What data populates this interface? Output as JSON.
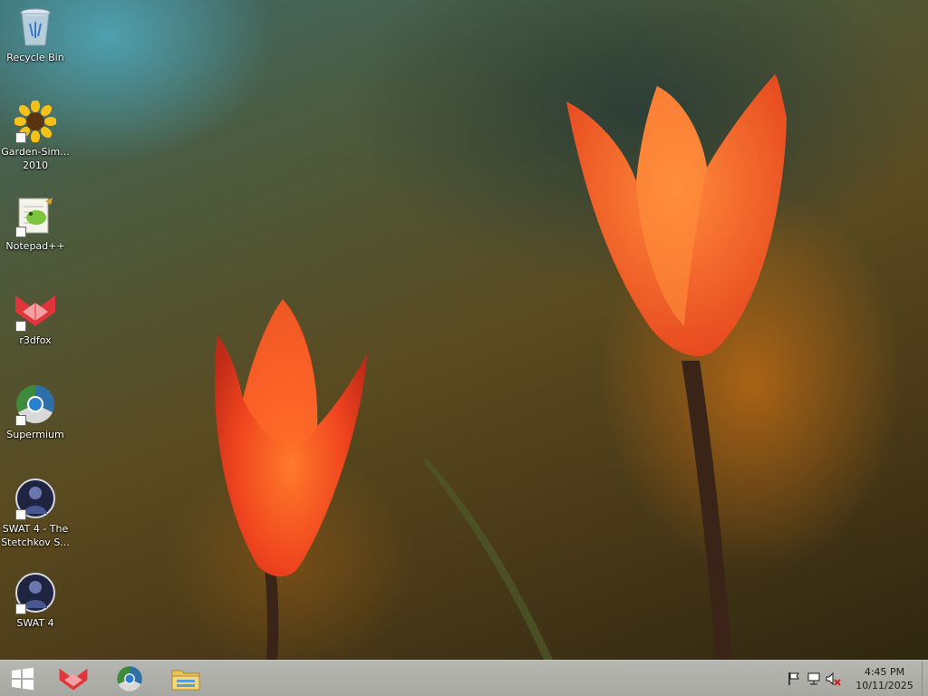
{
  "desktop": {
    "icons": [
      {
        "label": "Recycle Bin",
        "icon": "recycle-bin-icon",
        "shortcut": false
      },
      {
        "label": "Garden-Sim...\n2010",
        "icon": "sunflower-icon",
        "shortcut": true
      },
      {
        "label": "Notepad++",
        "icon": "notepad-plus-plus-icon",
        "shortcut": true
      },
      {
        "label": "r3dfox",
        "icon": "r3dfox-icon",
        "shortcut": true
      },
      {
        "label": "Supermium",
        "icon": "supermium-icon",
        "shortcut": true
      },
      {
        "label": "SWAT 4 - The\nStetchkov S...",
        "icon": "swat4-icon",
        "shortcut": true
      },
      {
        "label": "SWAT 4",
        "icon": "swat4-icon",
        "shortcut": true
      }
    ]
  },
  "taskbar": {
    "start_icon": "windows-logo-icon",
    "pinned": [
      {
        "name": "r3dfox",
        "icon": "r3dfox-icon"
      },
      {
        "name": "Supermium",
        "icon": "supermium-icon"
      },
      {
        "name": "File Explorer",
        "icon": "folder-icon"
      }
    ],
    "tray": {
      "icons": [
        "flag-icon",
        "network-icon",
        "volume-muted-icon"
      ],
      "time": "4:45 PM",
      "date": "10/11/2025"
    }
  },
  "colors": {
    "taskbar": "#aeaea8",
    "r3dfox_red": "#e0353a",
    "label_text": "#ffffff"
  }
}
